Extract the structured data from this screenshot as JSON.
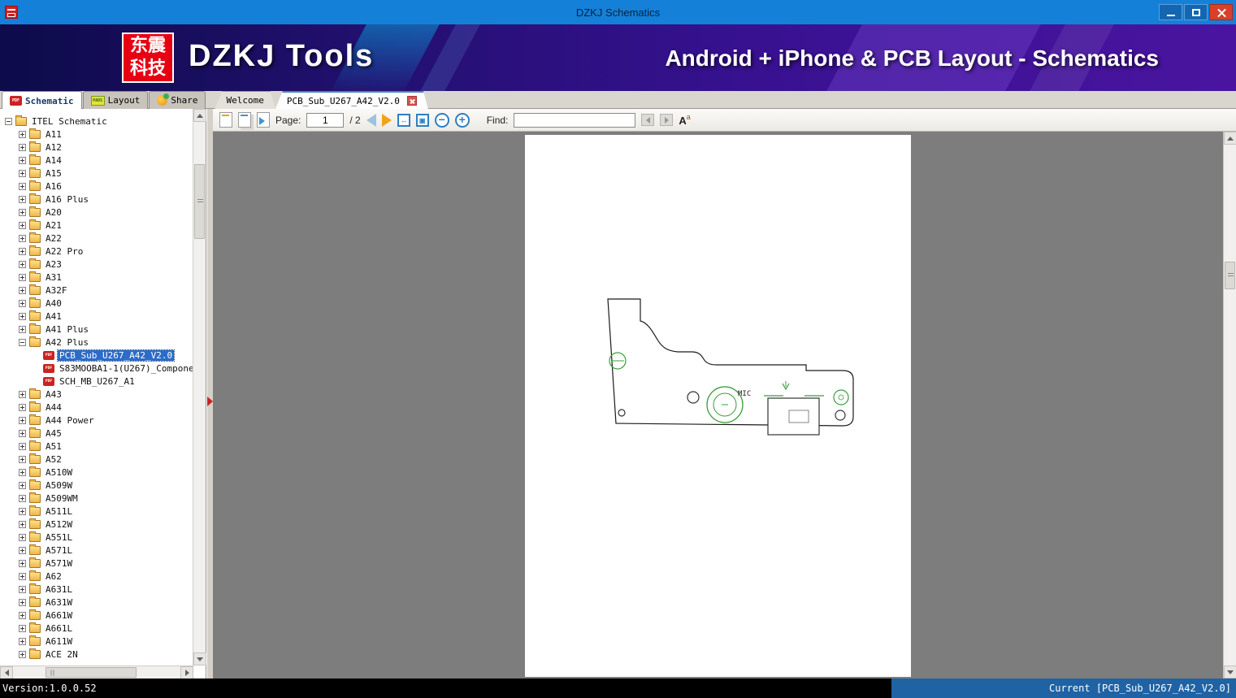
{
  "window": {
    "title": "DZKJ Schematics"
  },
  "banner": {
    "logo_line1": "东震",
    "logo_line2": "科技",
    "app_name": "DZKJ Tools",
    "tagline": "Android + iPhone & PCB Layout - Schematics"
  },
  "tabs": {
    "panel": [
      {
        "label": "Schematic"
      },
      {
        "label": "Layout"
      },
      {
        "label": "Share"
      }
    ],
    "documents": [
      {
        "label": "Welcome"
      },
      {
        "label": "PCB_Sub_U267_A42_V2.0"
      }
    ]
  },
  "toolbar": {
    "page_label": "Page:",
    "page_value": "1",
    "page_total": "/ 2",
    "find_label": "Find:",
    "find_value": ""
  },
  "tree": {
    "items": [
      {
        "label": "ITEL Schematic",
        "level": 0,
        "expand": "minus",
        "icon": "folder",
        "selected": false
      },
      {
        "label": "A11",
        "level": 1,
        "expand": "plus",
        "icon": "folder",
        "selected": false
      },
      {
        "label": "A12",
        "level": 1,
        "expand": "plus",
        "icon": "folder",
        "selected": false
      },
      {
        "label": "A14",
        "level": 1,
        "expand": "plus",
        "icon": "folder",
        "selected": false
      },
      {
        "label": "A15",
        "level": 1,
        "expand": "plus",
        "icon": "folder",
        "selected": false
      },
      {
        "label": "A16",
        "level": 1,
        "expand": "plus",
        "icon": "folder",
        "selected": false
      },
      {
        "label": "A16 Plus",
        "level": 1,
        "expand": "plus",
        "icon": "folder",
        "selected": false
      },
      {
        "label": "A20",
        "level": 1,
        "expand": "plus",
        "icon": "folder",
        "selected": false
      },
      {
        "label": "A21",
        "level": 1,
        "expand": "plus",
        "icon": "folder",
        "selected": false
      },
      {
        "label": "A22",
        "level": 1,
        "expand": "plus",
        "icon": "folder",
        "selected": false
      },
      {
        "label": "A22 Pro",
        "level": 1,
        "expand": "plus",
        "icon": "folder",
        "selected": false
      },
      {
        "label": "A23",
        "level": 1,
        "expand": "plus",
        "icon": "folder",
        "selected": false
      },
      {
        "label": "A31",
        "level": 1,
        "expand": "plus",
        "icon": "folder",
        "selected": false
      },
      {
        "label": "A32F",
        "level": 1,
        "expand": "plus",
        "icon": "folder",
        "selected": false
      },
      {
        "label": "A40",
        "level": 1,
        "expand": "plus",
        "icon": "folder",
        "selected": false
      },
      {
        "label": "A41",
        "level": 1,
        "expand": "plus",
        "icon": "folder",
        "selected": false
      },
      {
        "label": "A41 Plus",
        "level": 1,
        "expand": "plus",
        "icon": "folder",
        "selected": false
      },
      {
        "label": "A42 Plus",
        "level": 1,
        "expand": "minus",
        "icon": "folder",
        "selected": false
      },
      {
        "label": "PCB_Sub_U267_A42_V2.0",
        "level": 2,
        "expand": "none",
        "icon": "pdf",
        "selected": true
      },
      {
        "label": "S83MOOBA1-1(U267)_Compone",
        "level": 2,
        "expand": "none",
        "icon": "pdf",
        "selected": false
      },
      {
        "label": "SCH_MB_U267_A1",
        "level": 2,
        "expand": "none",
        "icon": "pdf",
        "selected": false
      },
      {
        "label": "A43",
        "level": 1,
        "expand": "plus",
        "icon": "folder",
        "selected": false
      },
      {
        "label": "A44",
        "level": 1,
        "expand": "plus",
        "icon": "folder",
        "selected": false
      },
      {
        "label": "A44 Power",
        "level": 1,
        "expand": "plus",
        "icon": "folder",
        "selected": false
      },
      {
        "label": "A45",
        "level": 1,
        "expand": "plus",
        "icon": "folder",
        "selected": false
      },
      {
        "label": "A51",
        "level": 1,
        "expand": "plus",
        "icon": "folder",
        "selected": false
      },
      {
        "label": "A52",
        "level": 1,
        "expand": "plus",
        "icon": "folder",
        "selected": false
      },
      {
        "label": "A510W",
        "level": 1,
        "expand": "plus",
        "icon": "folder",
        "selected": false
      },
      {
        "label": "A509W",
        "level": 1,
        "expand": "plus",
        "icon": "folder",
        "selected": false
      },
      {
        "label": "A509WM",
        "level": 1,
        "expand": "plus",
        "icon": "folder",
        "selected": false
      },
      {
        "label": "A511L",
        "level": 1,
        "expand": "plus",
        "icon": "folder",
        "selected": false
      },
      {
        "label": "A512W",
        "level": 1,
        "expand": "plus",
        "icon": "folder",
        "selected": false
      },
      {
        "label": "A551L",
        "level": 1,
        "expand": "plus",
        "icon": "folder",
        "selected": false
      },
      {
        "label": "A571L",
        "level": 1,
        "expand": "plus",
        "icon": "folder",
        "selected": false
      },
      {
        "label": "A571W",
        "level": 1,
        "expand": "plus",
        "icon": "folder",
        "selected": false
      },
      {
        "label": "A62",
        "level": 1,
        "expand": "plus",
        "icon": "folder",
        "selected": false
      },
      {
        "label": "A631L",
        "level": 1,
        "expand": "plus",
        "icon": "folder",
        "selected": false
      },
      {
        "label": "A631W",
        "level": 1,
        "expand": "plus",
        "icon": "folder",
        "selected": false
      },
      {
        "label": "A661W",
        "level": 1,
        "expand": "plus",
        "icon": "folder",
        "selected": false
      },
      {
        "label": "A661L",
        "level": 1,
        "expand": "plus",
        "icon": "folder",
        "selected": false
      },
      {
        "label": "A611W",
        "level": 1,
        "expand": "plus",
        "icon": "folder",
        "selected": false
      },
      {
        "label": "ACE 2N",
        "level": 1,
        "expand": "plus",
        "icon": "folder",
        "selected": false
      }
    ]
  },
  "viewer": {
    "page_indicator": "1 / 2",
    "drawing_labels": {
      "mic": "MIC"
    }
  },
  "statusbar": {
    "version": "Version:1.0.0.52",
    "current": "Current [PCB_Sub_U267_A42_V2.0]"
  },
  "colors": {
    "titlebar_blue": "#1580d8",
    "banner_from": "#0d0b4a",
    "banner_to": "#4a14a0",
    "logo_red": "#e60012",
    "close_red": "#d9402c",
    "selection_blue": "#2b6cc8",
    "status_blue": "#2063a5",
    "pdf_red": "#cc2222",
    "schematic_green": "#3a9c3a"
  }
}
